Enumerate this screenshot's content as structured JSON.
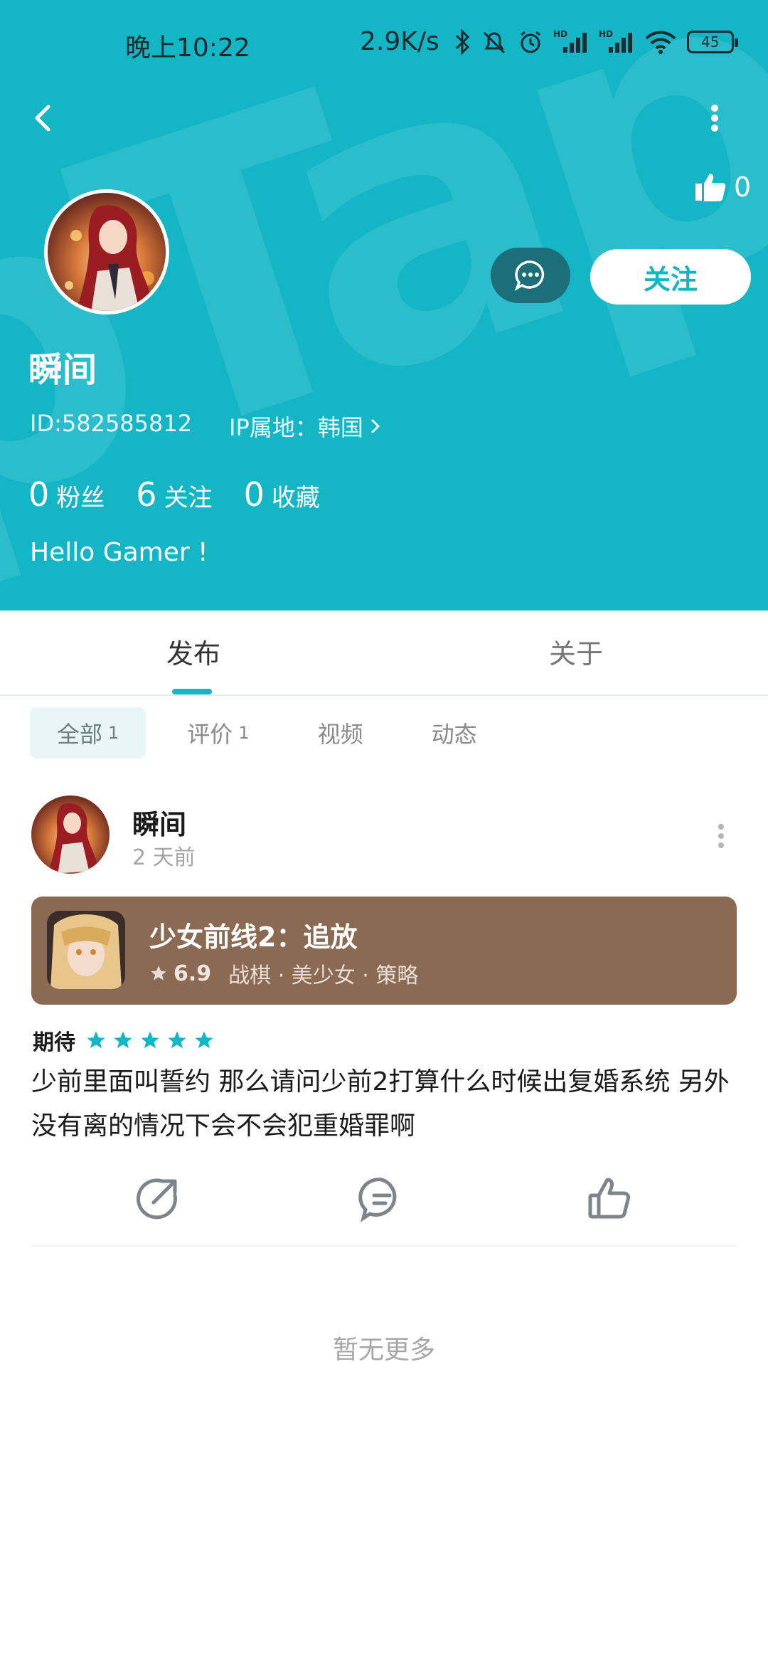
{
  "status_bar": {
    "time": "晚上10:22",
    "speed": "2.9K/s",
    "battery": "45",
    "icons": [
      "bluetooth-icon",
      "mute-icon",
      "alarm-icon",
      "signal-hd-icon",
      "signal-hd-icon",
      "wifi-icon",
      "battery-icon"
    ]
  },
  "header": {
    "back_icon": "chevron-left-icon",
    "more_icon": "vertical-dots-icon",
    "like_count": "0",
    "follow_label": "关注",
    "message_icon": "chat-bubble-icon",
    "username": "瞬间",
    "id_text": "ID:582585812",
    "ip_text": "IP属地：韩国",
    "stats": {
      "fans_num": "0",
      "fans_label": "粉丝",
      "following_num": "6",
      "following_label": "关注",
      "favorites_num": "0",
      "favorites_label": "收藏"
    },
    "bio": "Hello Gamer !",
    "colors": {
      "primary": "#14b6c6",
      "message_btn": "#1c6f78"
    }
  },
  "tabs": {
    "publish": "发布",
    "about": "关于"
  },
  "chips": {
    "all_label": "全部",
    "all_count": "1",
    "review_label": "评价",
    "review_count": "1",
    "video_label": "视频",
    "moments_label": "动态"
  },
  "post": {
    "author": "瞬间",
    "time": "2 天前",
    "game": {
      "title": "少女前线2：追放",
      "rating": "6.9",
      "tags": "战棋 · 美少女 · 策略",
      "card_color": "#8a6a53"
    },
    "expect_label": "期待",
    "stars": 5,
    "text": "少前里面叫誓约 那么请问少前2打算什么时候出复婚系统 另外没有离的情况下会不会犯重婚罪啊"
  },
  "footer": {
    "no_more": "暂无更多"
  }
}
